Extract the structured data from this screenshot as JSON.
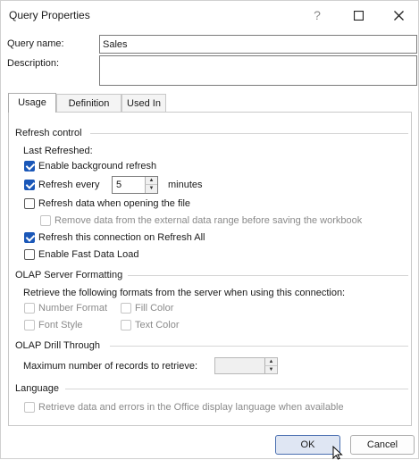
{
  "window": {
    "title": "Query Properties",
    "help": "?",
    "maximize": "☐",
    "close": "✕"
  },
  "fields": {
    "query_name_label": "Query name:",
    "query_name_value": "Sales",
    "description_label": "Description:",
    "description_value": ""
  },
  "tabs": [
    {
      "label": "Usage",
      "active": true
    },
    {
      "label": "Definition",
      "active": false
    },
    {
      "label": "Used In",
      "active": false
    }
  ],
  "refresh_control": {
    "title": "Refresh control",
    "last_refreshed": "Last Refreshed:",
    "background_refresh": {
      "label": "Enable background refresh",
      "checked": true
    },
    "refresh_every": {
      "label": "Refresh every",
      "checked": true,
      "value": "5",
      "unit": "minutes"
    },
    "refresh_on_open": {
      "label": "Refresh data when opening the file",
      "checked": false
    },
    "remove_data": {
      "label": "Remove data from the external data range before saving the workbook",
      "checked": false,
      "disabled": true
    },
    "refresh_all": {
      "label": "Refresh this connection on Refresh All",
      "checked": true
    },
    "fast_load": {
      "label": "Enable Fast Data Load",
      "checked": false
    }
  },
  "olap_formatting": {
    "title": "OLAP Server Formatting",
    "description": "Retrieve the following formats from the server when using this connection:",
    "number_format": "Number Format",
    "fill_color": "Fill Color",
    "font_style": "Font Style",
    "text_color": "Text Color"
  },
  "olap_drill": {
    "title": "OLAP Drill Through",
    "max_records_label": "Maximum number of records to retrieve:",
    "max_records_value": ""
  },
  "language": {
    "title": "Language",
    "retrieve_label": "Retrieve data and errors in the Office display language when available"
  },
  "buttons": {
    "ok": "OK",
    "cancel": "Cancel"
  },
  "icons": {
    "spin_up": "▲",
    "spin_down": "▼"
  }
}
